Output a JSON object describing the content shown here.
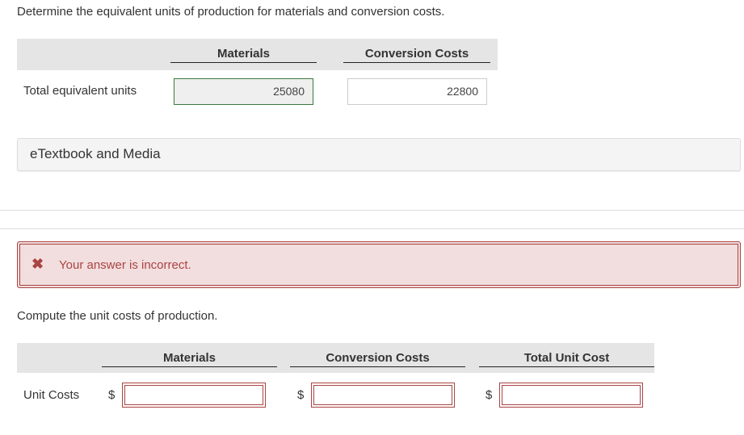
{
  "part1": {
    "instruction": "Determine the equivalent units of production for materials and conversion costs.",
    "columns": [
      "Materials",
      "Conversion Costs"
    ],
    "row_label": "Total equivalent units",
    "materials_value": "25080",
    "conversion_value": "22800",
    "materials_status": "correct"
  },
  "etextbook": {
    "label": "eTextbook and Media"
  },
  "feedback": {
    "icon": "x-mark-icon",
    "message": "Your answer is incorrect.",
    "color": "#a94442"
  },
  "part2": {
    "instruction": "Compute the unit costs of production.",
    "columns": [
      "Materials",
      "Conversion Costs",
      "Total Unit Cost"
    ],
    "row_label": "Unit Costs",
    "currency": "$",
    "values": [
      "",
      "",
      ""
    ]
  }
}
